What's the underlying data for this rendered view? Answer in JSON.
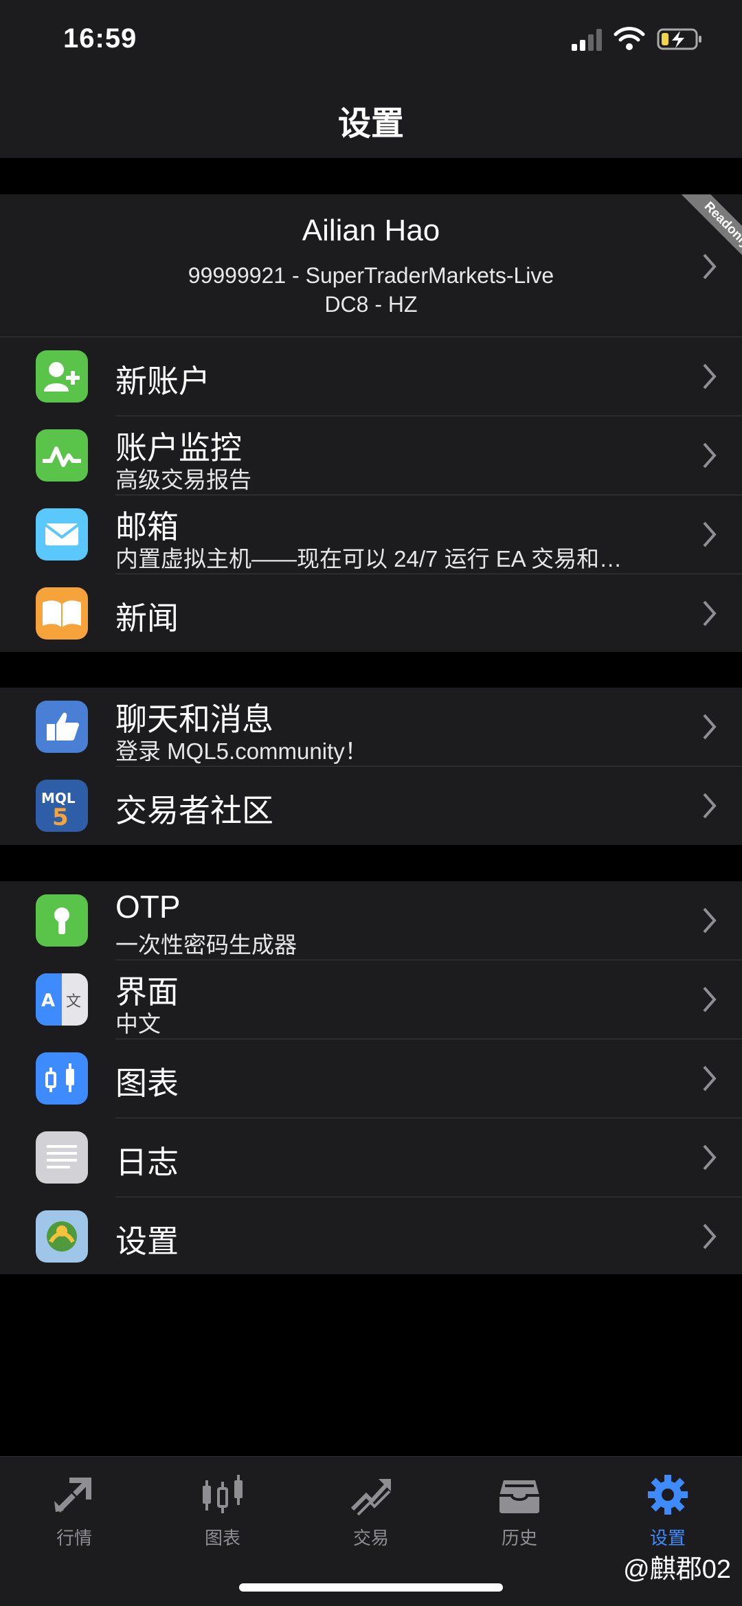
{
  "status_bar": {
    "time": "16:59"
  },
  "header": {
    "title": "设置"
  },
  "account": {
    "name": "Ailian Hao",
    "line1": "99999921 - SuperTraderMarkets-Live",
    "line2": "DC8 - HZ",
    "ribbon": "Readonly"
  },
  "group1": [
    {
      "label": "新账户",
      "icon": "add-user-icon",
      "color": "#5ac34a"
    },
    {
      "label": "账户监控",
      "sub": "高级交易报告",
      "icon": "monitor-chart-icon",
      "color": "#5ac34a"
    },
    {
      "label": "邮箱",
      "sub": "内置虚拟主机——现在可以 24/7 运行 EA 交易和…",
      "icon": "mail-icon",
      "color": "#5ac8fa"
    },
    {
      "label": "新闻",
      "icon": "book-icon",
      "color": "#f7a33b"
    }
  ],
  "group2": [
    {
      "label": "聊天和消息",
      "sub": "登录 MQL5.community！",
      "icon": "thumbs-up-icon",
      "color": "#4a7fd6"
    },
    {
      "label": "交易者社区",
      "icon": "mql5-icon",
      "color": "#2f5ea8"
    }
  ],
  "group3": [
    {
      "label": "OTP",
      "sub": "一次性密码生成器",
      "icon": "keyhole-icon",
      "color": "#5ac34a"
    },
    {
      "label": "界面",
      "sub": "中文",
      "icon": "translate-icon",
      "color": "#3d8bfd"
    },
    {
      "label": "图表",
      "icon": "candlestick-icon",
      "color": "#3d8bfd"
    },
    {
      "label": "日志",
      "icon": "journal-icon",
      "color": "#c7c7cc"
    },
    {
      "label": "设置",
      "icon": "metatrader-icon",
      "color": "#9fc6e8"
    }
  ],
  "tabs": [
    {
      "label": "行情",
      "icon": "quotes-icon"
    },
    {
      "label": "图表",
      "icon": "chart-icon"
    },
    {
      "label": "交易",
      "icon": "trade-icon"
    },
    {
      "label": "历史",
      "icon": "history-icon"
    },
    {
      "label": "设置",
      "icon": "settings-gear-icon",
      "active": true
    }
  ],
  "watermark": "@麒郡02"
}
